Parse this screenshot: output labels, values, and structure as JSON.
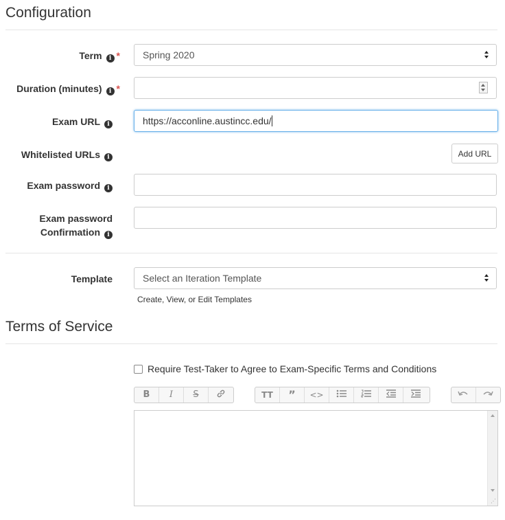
{
  "config": {
    "title": "Configuration",
    "term": {
      "label": "Term",
      "value": "Spring 2020",
      "required": "*"
    },
    "duration": {
      "label": "Duration (minutes)",
      "value": "",
      "required": "*"
    },
    "exam_url": {
      "label": "Exam URL",
      "value": "https://acconline.austincc.edu/"
    },
    "whitelisted": {
      "label": "Whitelisted URLs",
      "add_button": "Add URL"
    },
    "exam_password": {
      "label": "Exam password",
      "value": ""
    },
    "exam_password_confirm": {
      "label_line1": "Exam password",
      "label_line2": "Confirmation",
      "value": ""
    },
    "template": {
      "label": "Template",
      "value": "Select an Iteration Template",
      "link": "Create, View, or Edit Templates"
    }
  },
  "tos": {
    "title": "Terms of Service",
    "checkbox_label": "Require Test-Taker to Agree to Exam-Specific Terms and Conditions",
    "checked": false,
    "editor_value": ""
  },
  "toolbar": {
    "group1": [
      "bold-icon",
      "italic-icon",
      "strikethrough-icon",
      "link-icon"
    ],
    "group2": [
      "heading-icon",
      "quote-icon",
      "code-icon",
      "bulleted-list-icon",
      "numbered-list-icon",
      "outdent-icon",
      "indent-icon"
    ],
    "group3": [
      "undo-icon",
      "redo-icon"
    ]
  },
  "info_glyph": "i"
}
